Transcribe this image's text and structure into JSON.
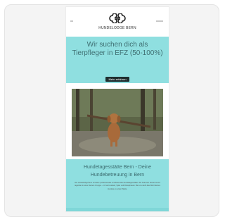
{
  "site": {
    "logo_text": "HUNDELODGE BERN"
  },
  "hero": {
    "title": "Wir suchen dich als Tierpfleger in EFZ (50-100%)",
    "button_label": "Mehr erfahren"
  },
  "photo": {
    "alt": "Dog carrying a stick in a forest",
    "colors": {
      "forest": "#4e5a3c",
      "dog": "#a86a3a",
      "ground": "#6b6a5c"
    }
  },
  "section": {
    "title": "Hundetagesstätte Bern - Deine Hundebetreuung in Bern",
    "body": "Die Hundelodge Bern ist deine professionelle und liebevolle Hundetagesstätte. Wir betreuen deinen Hund tagsüber in einer kleinen Gruppe – mit viel Auslauf, Spiel und Ruhephasen. Bei uns steht das Wohl deines Hundes an erster Stelle."
  },
  "colors": {
    "accent": "#8fdfe0",
    "button": "#1f2e2f",
    "text": "#3f6f72"
  }
}
